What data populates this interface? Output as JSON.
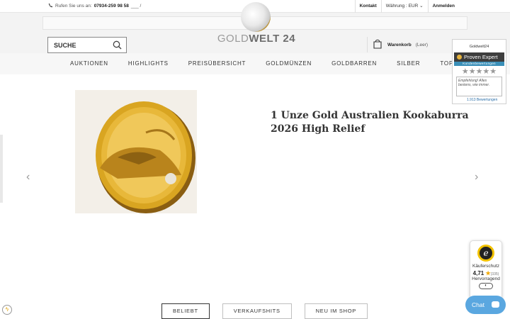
{
  "topbar": {
    "phone_prefix": "Rufen Sie uns an:",
    "phone_number": "07934-259 98 58",
    "phone_suffix": "___ /",
    "kontakt": "Kontakt",
    "currency": "Währung : EUR",
    "login": "Anmelden"
  },
  "search": {
    "placeholder": "SUCHE"
  },
  "logo": {
    "text_light": "GOLD",
    "text_dark": "WELT 24"
  },
  "cart": {
    "label": "Warenkorb",
    "status": "(Leer)"
  },
  "nav": {
    "items": [
      "AUKTIONEN",
      "HIGHLIGHTS",
      "PREISÜBERSICHT",
      "GOLDMÜNZEN",
      "GOLDBARREN",
      "SILBER",
      "TOP-SPARPLÄNE"
    ]
  },
  "product": {
    "title": "1 Unze Gold Australien Kookaburra 2026 High Relief",
    "image_icon": "gold-coin-image"
  },
  "tabs": [
    {
      "label": "BELIEBT",
      "active": true
    },
    {
      "label": "VERKAUFSHITS",
      "active": false
    },
    {
      "label": "NEU IM SHOP",
      "active": false
    }
  ],
  "proven_expert": {
    "brand": "Goldwelt24",
    "name": "Proven Expert",
    "subtitle": "Kundenbewertungen",
    "stars": "★★★★★",
    "quote": "Empfehlung! Alles bestens, wie immer.",
    "count": "1.913 Bewertungen"
  },
  "trusted_shops": {
    "label": "Käuferschutz",
    "rating": "4,71",
    "reviews": "(335)",
    "verdict": "Hervorragend"
  },
  "chat": {
    "label": "Chat"
  },
  "colors": {
    "accent_blue": "#5aa7e0",
    "gold": "#c9a23a"
  }
}
